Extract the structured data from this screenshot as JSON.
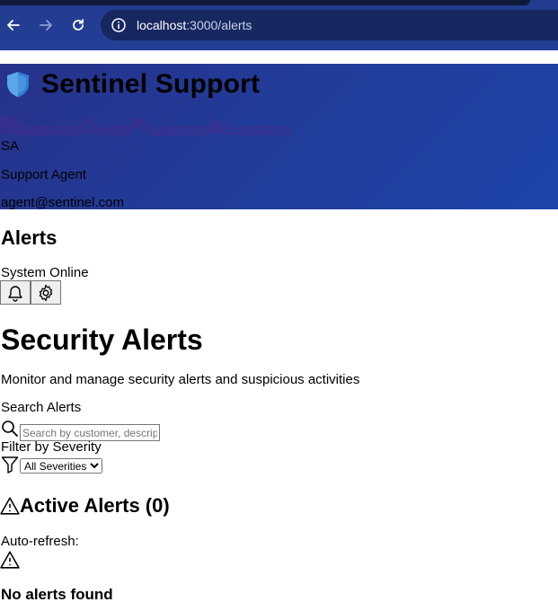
{
  "browser": {
    "url_host": "localhost",
    "url_rest": ":3000/alerts"
  },
  "header": {
    "brand": "Sentinel Support",
    "nav": [
      {
        "label": "Dashboard",
        "icon": "grid-icon"
      },
      {
        "label": "Alerts",
        "icon": "alert-triangle-icon"
      },
      {
        "label": "Customers",
        "icon": "users-icon"
      },
      {
        "label": "Evaluations",
        "icon": "chart-icon"
      }
    ],
    "user": {
      "initials": "SA",
      "role": "Support Agent",
      "email": "agent@sentinel.com"
    }
  },
  "topbar": {
    "title": "Alerts",
    "status": "System Online"
  },
  "main": {
    "title": "Security Alerts",
    "description": "Monitor and manage security alerts and suspicious activities",
    "search": {
      "label": "Search Alerts",
      "placeholder": "Search by customer, description..."
    },
    "filter": {
      "label": "Filter by Severity",
      "selected": "All Severities"
    },
    "active_alerts_title": "Active Alerts (0)",
    "auto_refresh_label": "Auto-refresh:",
    "empty_title": "No alerts found"
  },
  "colors": {
    "header_gradient_start": "#27328a",
    "header_gradient_end": "#1e44ab",
    "chrome_bg": "#213c8f",
    "link": "#4b2a8a"
  }
}
